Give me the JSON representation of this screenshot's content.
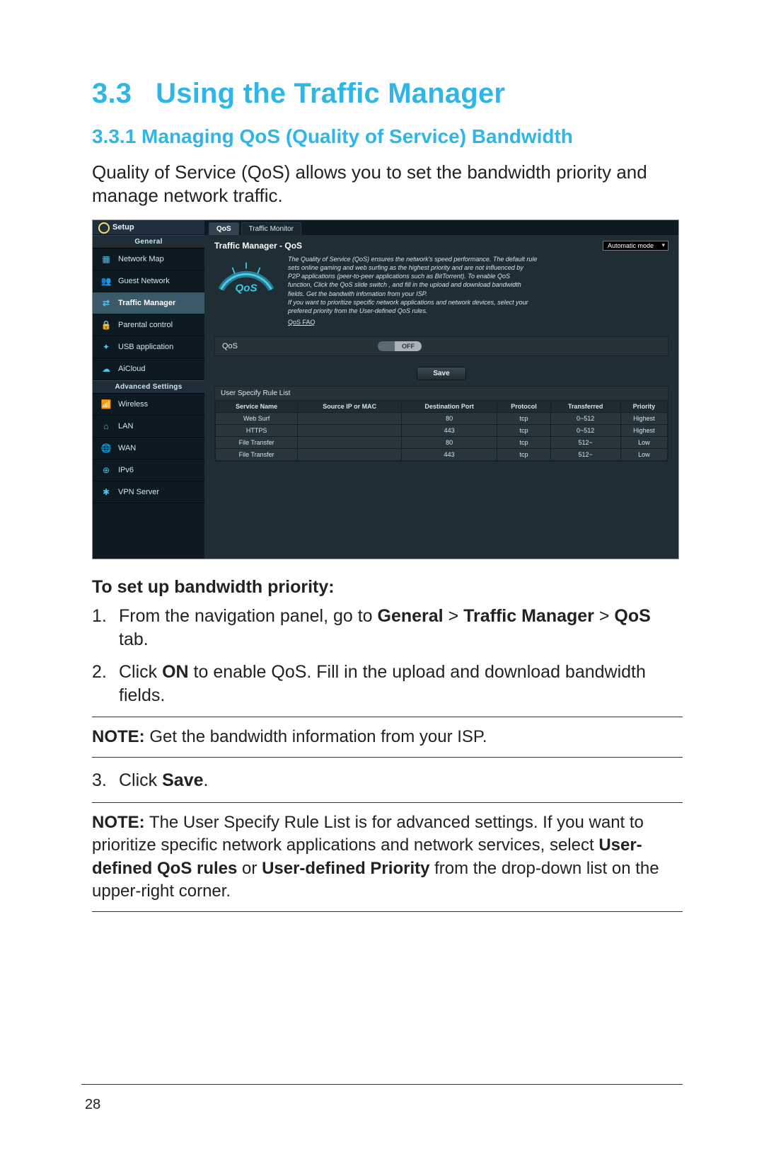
{
  "section_number": "3.3",
  "section_title": "Using the Traffic Manager",
  "subsection_title": "3.3.1 Managing QoS (Quality of Service) Bandwidth",
  "intro_paragraph": "Quality of Service (QoS) allows you to set the bandwidth priority and manage network traffic.",
  "screenshot": {
    "setup_label": "Setup",
    "sidebar": {
      "general_heading": "General",
      "general_items": [
        {
          "icon": "map",
          "label": "Network Map"
        },
        {
          "icon": "guest",
          "label": "Guest Network"
        },
        {
          "icon": "traffic",
          "label": "Traffic Manager",
          "active": true
        },
        {
          "icon": "lock",
          "label": "Parental control"
        },
        {
          "icon": "usb",
          "label": "USB application"
        },
        {
          "icon": "cloud",
          "label": "AiCloud"
        }
      ],
      "advanced_heading": "Advanced Settings",
      "advanced_items": [
        {
          "icon": "wifi",
          "label": "Wireless"
        },
        {
          "icon": "lan",
          "label": "LAN"
        },
        {
          "icon": "wan",
          "label": "WAN"
        },
        {
          "icon": "ipv6",
          "label": "IPv6"
        },
        {
          "icon": "vpn",
          "label": "VPN Server"
        }
      ]
    },
    "tabs": [
      {
        "label": "QoS",
        "active": true
      },
      {
        "label": "Traffic Monitor"
      }
    ],
    "panel_title": "Traffic Manager - QoS",
    "mode_select": "Automatic mode",
    "gauge_label": "QoS",
    "description_lines": [
      "The Quality of Service (QoS) ensures the network's speed performance. The default rule",
      "sets online gaming and web surfing as the highest priority and are not influenced by",
      "P2P applications (peer-to-peer applications such as BitTorrent). To enable QoS",
      "function, Click the QoS slide switch , and fill in the upload and download bandwidth",
      "fields. Get the bandwith infomation from your ISP.",
      "If you want to prioritize specific network applications and network devices, select your",
      "prefered priority from the User-defined QoS rules."
    ],
    "faq_link": "QoS FAQ",
    "qos_label": "QoS",
    "toggle_value": "OFF",
    "save_label": "Save",
    "rule_list_title": "User Specify Rule List",
    "table": {
      "headers": [
        "Service Name",
        "Source IP or MAC",
        "Destination Port",
        "Protocol",
        "Transferred",
        "Priority"
      ],
      "rows": [
        [
          "Web Surf",
          "",
          "80",
          "tcp",
          "0~512",
          "Highest"
        ],
        [
          "HTTPS",
          "",
          "443",
          "tcp",
          "0~512",
          "Highest"
        ],
        [
          "File Transfer",
          "",
          "80",
          "tcp",
          "512~",
          "Low"
        ],
        [
          "File Transfer",
          "",
          "443",
          "tcp",
          "512~",
          "Low"
        ]
      ]
    }
  },
  "steps_heading": "To set up bandwidth priority:",
  "step1_pre": "From the navigation panel, go to ",
  "step1_b1": "General",
  "step1_gt1": " > ",
  "step1_b2": "Traffic Manager",
  "step1_gt2": " > ",
  "step1_b3": "QoS",
  "step1_post": " tab.",
  "step2_pre": "Click ",
  "step2_b1": "ON",
  "step2_post": " to enable QoS. Fill in the upload and download bandwidth fields.",
  "note1_b": "NOTE:",
  "note1_text": " Get the bandwidth information from your ISP.",
  "step3_pre": "Click ",
  "step3_b1": "Save",
  "step3_post": ".",
  "note2_b": "NOTE:",
  "note2_t1": "  The User Specify Rule List is for advanced settings. If you want to prioritize specific network applications and network services, select ",
  "note2_b2": "User-defined QoS rules",
  "note2_or": " or ",
  "note2_b3": "User-defined Priority",
  "note2_t2": " from the drop-down list on the upper-right corner.",
  "page_number": "28"
}
